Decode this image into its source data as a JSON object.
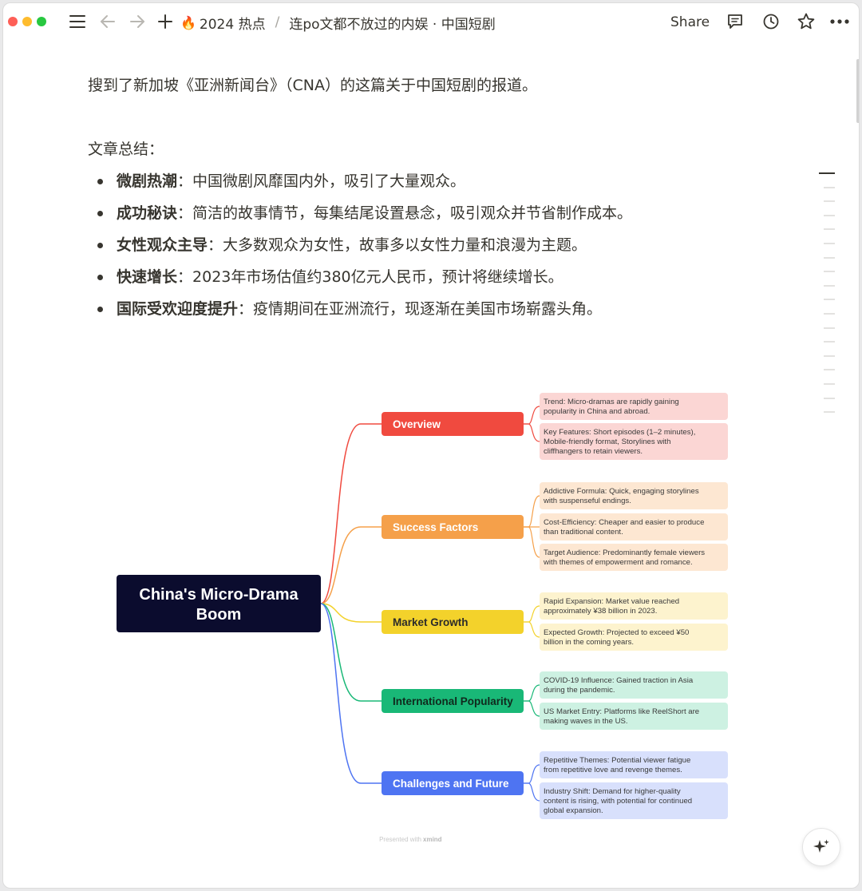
{
  "topbar": {
    "breadcrumb_parent_emoji": "🔥",
    "breadcrumb_parent": "2024 热点",
    "breadcrumb_separator": "/",
    "breadcrumb_current": "连po文都不放过的内娱 · 中国短剧",
    "share_label": "Share",
    "icons": [
      "menu-icon",
      "back-arrow-icon",
      "forward-arrow-icon",
      "plus-icon",
      "comment-icon",
      "history-clock-icon",
      "star-icon",
      "more-icon"
    ]
  },
  "document": {
    "intro": "搜到了新加坡《亚洲新闻台》（CNA）的这篇关于中国短剧的报道。",
    "summary_heading": "文章总结：",
    "bullets": [
      {
        "title": "微剧热潮",
        "text": "：中国微剧风靡国内外，吸引了大量观众。"
      },
      {
        "title": "成功秘诀",
        "text": "：简洁的故事情节，每集结尾设置悬念，吸引观众并节省制作成本。"
      },
      {
        "title": "女性观众主导",
        "text": "：大多数观众为女性，故事多以女性力量和浪漫为主题。"
      },
      {
        "title": "快速增长",
        "text": "：2023年市场估值约380亿元人民币，预计将继续增长。"
      },
      {
        "title": "国际受欢迎度提升",
        "text": "：疫情期间在亚洲流行，现逐渐在美国市场崭露头角。"
      }
    ]
  },
  "mindmap": {
    "root": [
      "China's Micro-Drama",
      "Boom"
    ],
    "footer": [
      "Presented with ",
      "xmind"
    ],
    "branches": [
      {
        "label": "Overview",
        "color": "#f04a3f",
        "light": "#fbd6d4",
        "leaves": [
          [
            "Trend: Micro-dramas are rapidly gaining",
            "popularity in China and abroad."
          ],
          [
            "Key Features: Short episodes (1–2 minutes),",
            "Mobile-friendly format, Storylines with",
            "cliffhangers to retain viewers."
          ]
        ]
      },
      {
        "label": "Success Factors",
        "color": "#f5a04a",
        "light": "#fde7d2",
        "leaves": [
          [
            "Addictive Formula: Quick, engaging storylines",
            "with suspenseful endings."
          ],
          [
            "Cost-Efficiency: Cheaper and easier to produce",
            "than traditional content."
          ],
          [
            "Target Audience: Predominantly female viewers",
            "with themes of empowerment and romance."
          ]
        ]
      },
      {
        "label": "Market Growth",
        "color": "#f3d22b",
        "light": "#fdf3ce",
        "leaves": [
          [
            "Rapid Expansion: Market value reached",
            "approximately ¥38 billion in 2023."
          ],
          [
            "Expected Growth: Projected to exceed ¥50",
            "billion in the coming years."
          ]
        ]
      },
      {
        "label": "International Popularity",
        "color": "#19b877",
        "light": "#cdf1e2",
        "leaves": [
          [
            "COVID-19 Influence: Gained traction in Asia",
            "during the pandemic."
          ],
          [
            "US Market Entry: Platforms like ReelShort are",
            "making waves in the US."
          ]
        ]
      },
      {
        "label": "Challenges and Future",
        "color": "#4e74f2",
        "light": "#d8e0fc",
        "leaves": [
          [
            "Repetitive Themes: Potential viewer fatigue",
            "from repetitive love and revenge themes."
          ],
          [
            "Industry Shift: Demand for higher-quality",
            "content is rising, with potential for continued",
            "global expansion."
          ]
        ]
      }
    ]
  },
  "colors": {
    "root_bg": "#0b0c2e",
    "text": "#37352f"
  }
}
